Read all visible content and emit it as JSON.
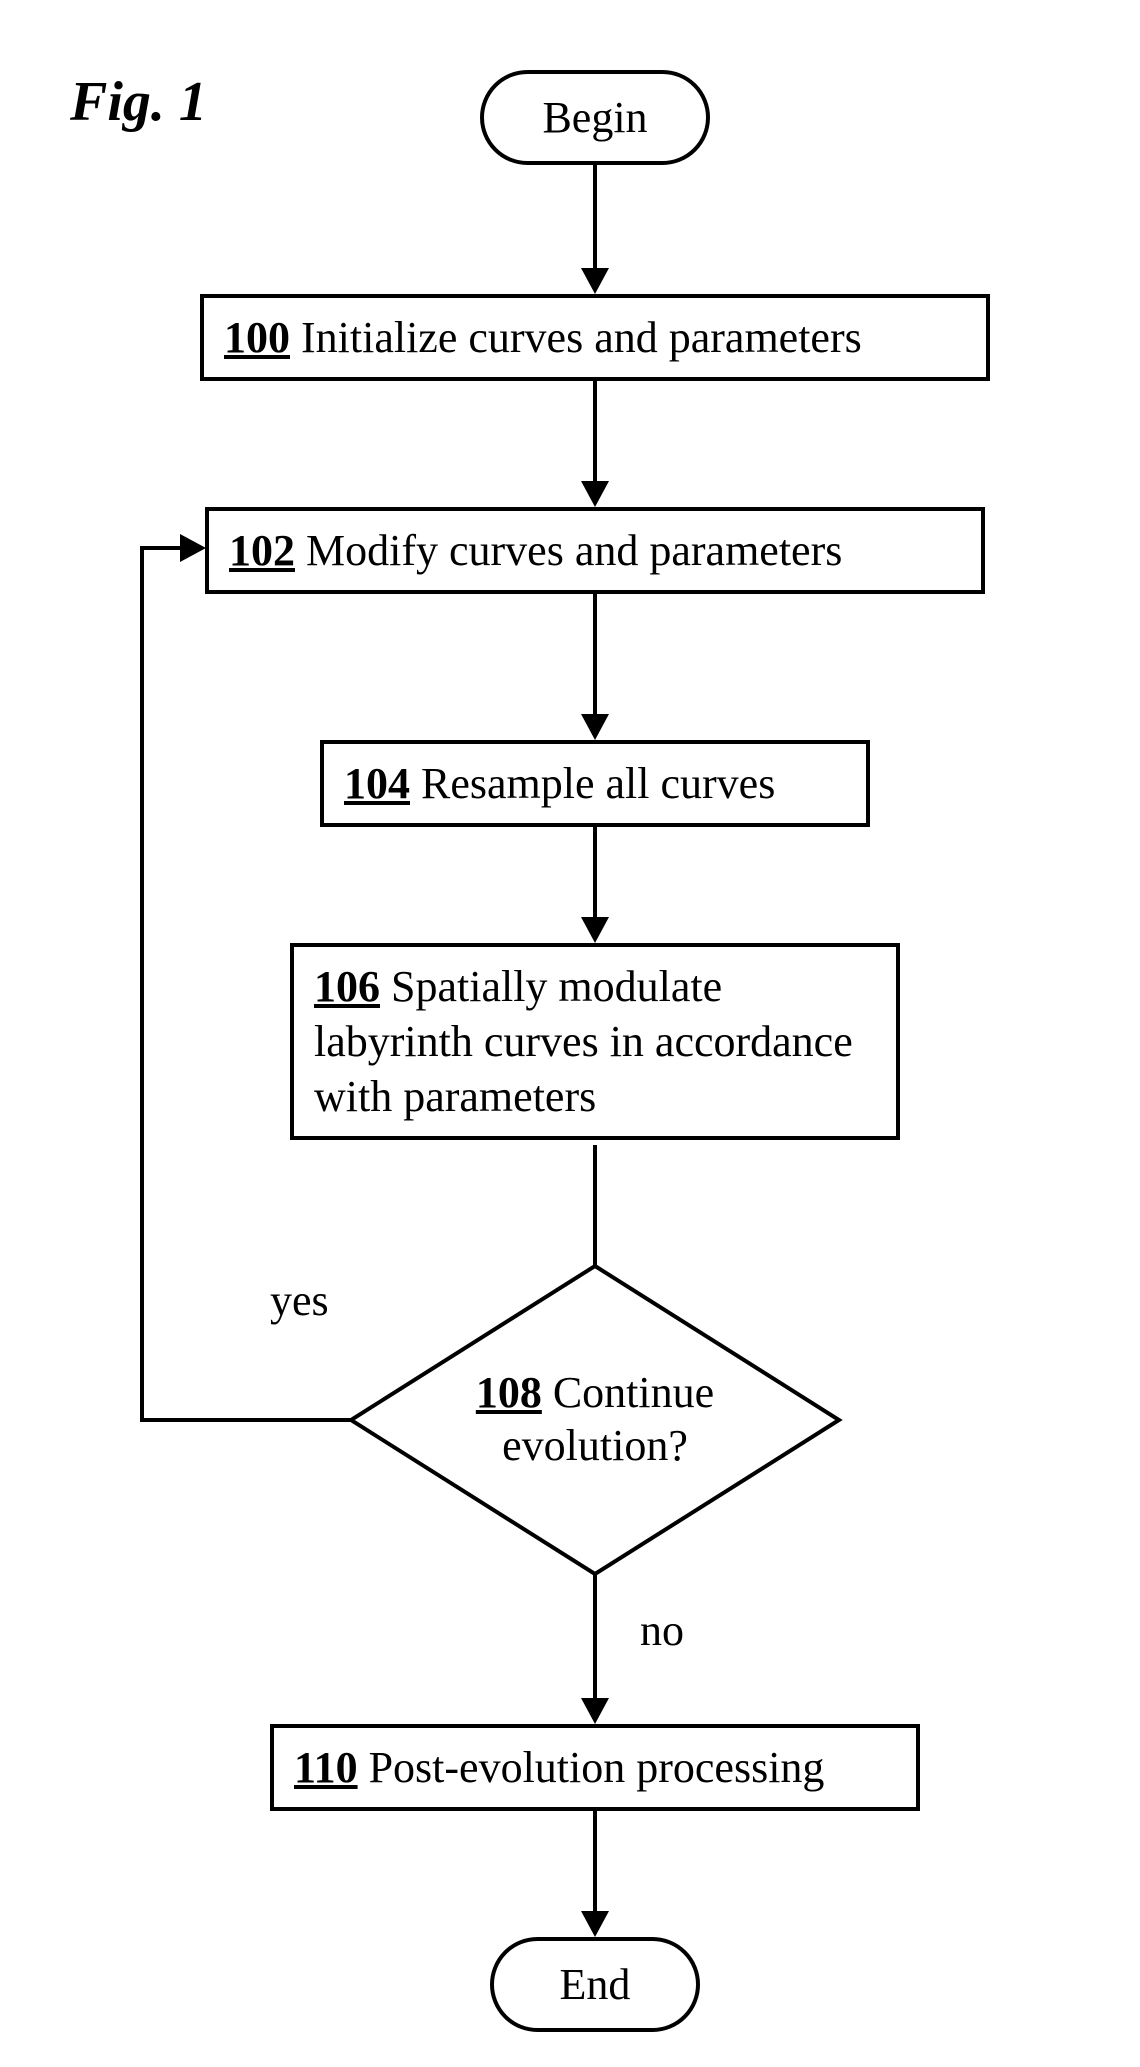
{
  "figure_title": "Fig. 1",
  "terminals": {
    "begin": "Begin",
    "end": "End"
  },
  "steps": {
    "s100": {
      "num": "100",
      "text": " Initialize curves and parameters"
    },
    "s102": {
      "num": "102",
      "text": " Modify curves and parameters"
    },
    "s104": {
      "num": "104",
      "text": " Resample all curves"
    },
    "s106": {
      "num": "106",
      "text": " Spatially modulate labyrinth curves in accordance with parameters"
    },
    "s108": {
      "num": "108",
      "text_line1": " Continue",
      "text_line2": "evolution?"
    },
    "s110": {
      "num": "110",
      "text": " Post-evolution processing"
    }
  },
  "edges": {
    "yes": "yes",
    "no": "no"
  },
  "chart_data": {
    "type": "flowchart",
    "nodes": [
      {
        "id": "begin",
        "shape": "terminal",
        "label": "Begin"
      },
      {
        "id": "100",
        "shape": "process",
        "label": "100 Initialize curves and parameters"
      },
      {
        "id": "102",
        "shape": "process",
        "label": "102 Modify curves and parameters"
      },
      {
        "id": "104",
        "shape": "process",
        "label": "104 Resample all curves"
      },
      {
        "id": "106",
        "shape": "process",
        "label": "106 Spatially modulate labyrinth curves in accordance with parameters"
      },
      {
        "id": "108",
        "shape": "decision",
        "label": "108 Continue evolution?"
      },
      {
        "id": "110",
        "shape": "process",
        "label": "110 Post-evolution processing"
      },
      {
        "id": "end",
        "shape": "terminal",
        "label": "End"
      }
    ],
    "edges": [
      {
        "from": "begin",
        "to": "100"
      },
      {
        "from": "100",
        "to": "102"
      },
      {
        "from": "102",
        "to": "104"
      },
      {
        "from": "104",
        "to": "106"
      },
      {
        "from": "106",
        "to": "108"
      },
      {
        "from": "108",
        "to": "102",
        "label": "yes"
      },
      {
        "from": "108",
        "to": "110",
        "label": "no"
      },
      {
        "from": "110",
        "to": "end"
      }
    ]
  }
}
